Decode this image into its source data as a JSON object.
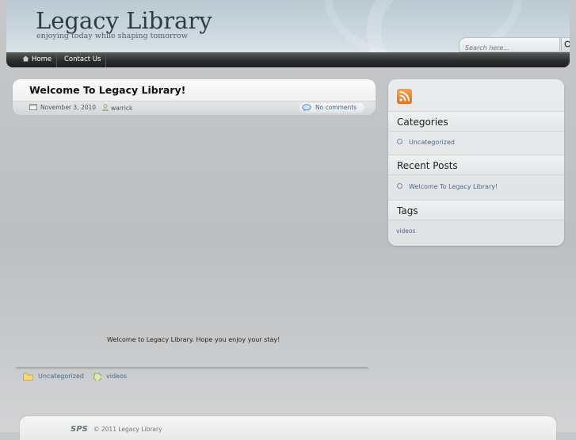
{
  "header": {
    "site_title": "Legacy Library",
    "tagline": "enjoying today while shaping tomorrow",
    "search_placeholder": "Search here...",
    "search_icon": "search-icon"
  },
  "nav": {
    "items": [
      {
        "label": "Home",
        "icon": "home-icon"
      },
      {
        "label": "Contact Us"
      }
    ]
  },
  "post": {
    "title": "Welcome To Legacy Library!",
    "date": "November 3, 2010",
    "author": "warrick",
    "comments": "No comments",
    "body": "Welcome to Legacy Library. Hope you enjoy your stay!",
    "category": "Uncategorized",
    "tag": "videos"
  },
  "sidebar": {
    "rss_icon": "rss-icon",
    "categories_heading": "Categories",
    "categories": [
      "Uncategorized"
    ],
    "recent_heading": "Recent Posts",
    "recent_posts": [
      "Welcome To Legacy Library!"
    ],
    "tags_heading": "Tags",
    "tags": [
      "videos"
    ]
  },
  "footer": {
    "logo": "SPS",
    "copyright": "© 2011 Legacy Library"
  },
  "colors": {
    "link": "#4a6a8a",
    "nav_bg": "#2c2d2e",
    "rss": "#f08a2c"
  }
}
